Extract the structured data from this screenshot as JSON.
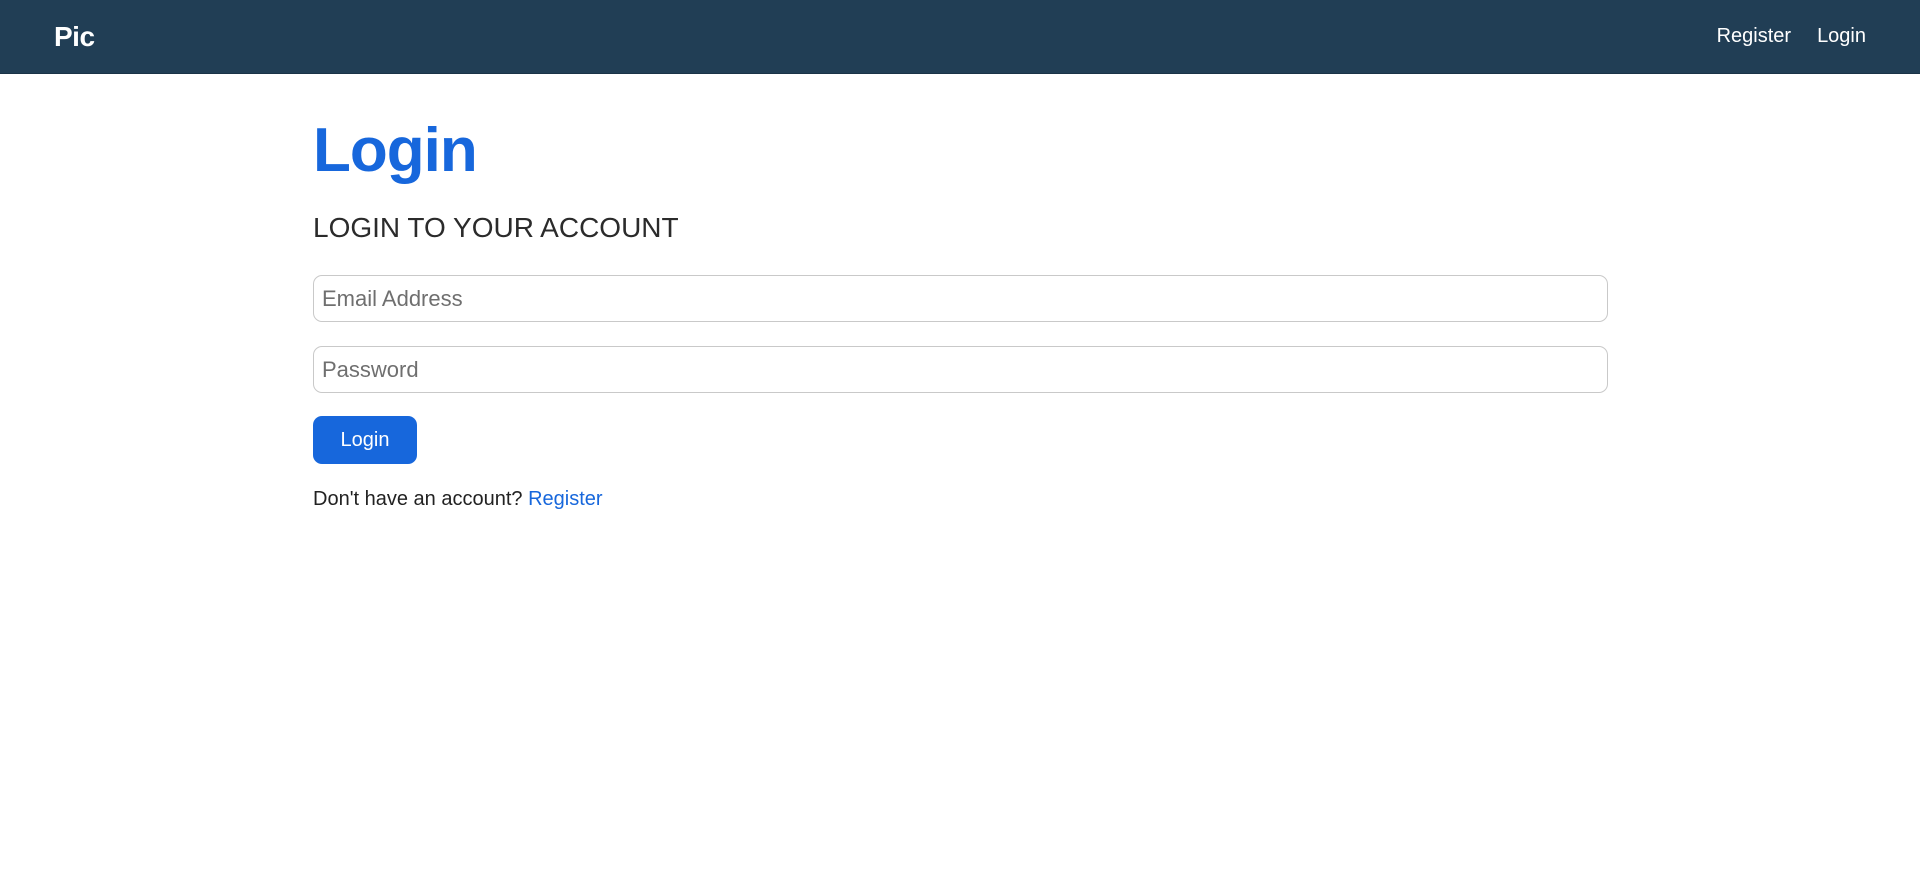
{
  "navbar": {
    "brand": "Pic",
    "links": [
      "Register",
      "Login"
    ]
  },
  "main": {
    "title": "Login",
    "subtitle": "LOGIN TO YOUR ACCOUNT",
    "email_placeholder": "Email Address",
    "password_placeholder": "Password",
    "submit_label": "Login",
    "footer_prompt": "Don't have an account?",
    "footer_link": "Register"
  },
  "colors": {
    "navbar_bg": "#213e55",
    "accent": "#1767dc"
  }
}
